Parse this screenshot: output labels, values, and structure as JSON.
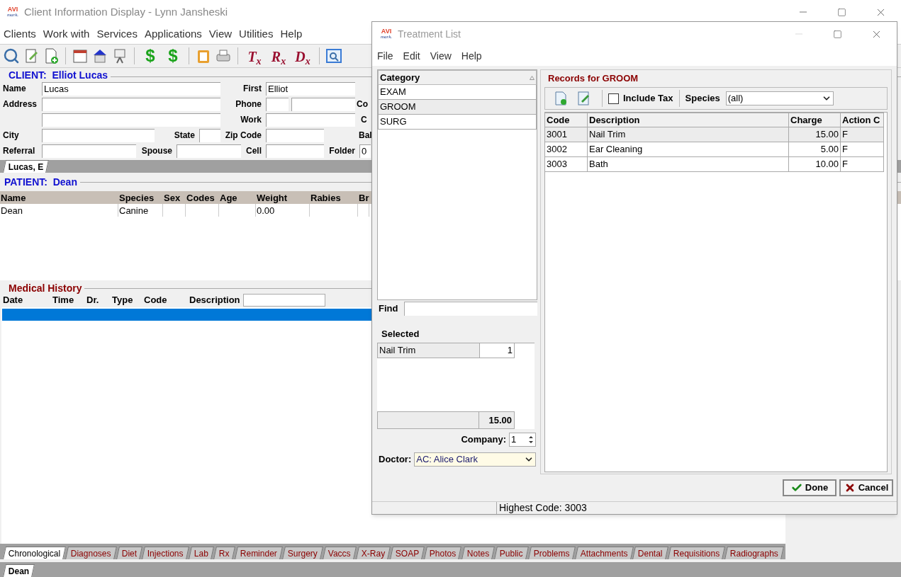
{
  "main_window": {
    "logo": {
      "top": "AVI",
      "bottom": "mark."
    },
    "title": "Client Information Display - Lynn Jansheski"
  },
  "menu": [
    "Clients",
    "Work with",
    "Services",
    "Applications",
    "View",
    "Utilities",
    "Help"
  ],
  "toolbar": {
    "symbols": [
      "$",
      "$",
      "T$_{x}$",
      "R$_{x}$",
      "D$_{x}$"
    ]
  },
  "client": {
    "heading": "CLIENT:  Elliot Lucas",
    "labels": {
      "name": "Name",
      "first": "First",
      "address": "Address",
      "phone": "Phone",
      "work": "Work",
      "city": "City",
      "state": "State",
      "zip": "Zip Code",
      "referral": "Referral",
      "spouse": "Spouse",
      "cell": "Cell",
      "folder": "Folder"
    },
    "cut_labels": [
      "Co",
      "C",
      "Bal"
    ],
    "values": {
      "name": "Lucas",
      "first": "Elliot",
      "folder": "0"
    }
  },
  "client_tabs": [
    {
      "label": "Lucas, E",
      "selected": true
    }
  ],
  "patient": {
    "heading": "PATIENT:  Dean",
    "columns": [
      "Name",
      "Species",
      "Sex",
      "Codes",
      "Age",
      "Weight",
      "Rabies",
      "Br"
    ],
    "rows": [
      [
        "Dean",
        "Canine",
        "",
        "",
        "",
        "0.00",
        "",
        ""
      ]
    ]
  },
  "medical_history": {
    "heading": "Medical History",
    "columns": [
      "Date",
      "Time",
      "Dr.",
      "Type",
      "Code",
      "Description"
    ]
  },
  "history_tabs": [
    {
      "label": "Chronological",
      "selected": true
    },
    {
      "label": "Diagnoses",
      "selected": false
    },
    {
      "label": "Diet",
      "selected": false
    },
    {
      "label": "Injections",
      "selected": false
    },
    {
      "label": "Lab",
      "selected": false
    },
    {
      "label": "Rx",
      "selected": false
    },
    {
      "label": "Reminder",
      "selected": false
    },
    {
      "label": "Surgery",
      "selected": false
    },
    {
      "label": "Vaccs",
      "selected": false
    },
    {
      "label": "X-Ray",
      "selected": false
    },
    {
      "label": "SOAP",
      "selected": false
    },
    {
      "label": "Photos",
      "selected": false
    },
    {
      "label": "Notes",
      "selected": false
    },
    {
      "label": "Public",
      "selected": false
    },
    {
      "label": "Problems",
      "selected": false
    },
    {
      "label": "Attachments",
      "selected": false
    },
    {
      "label": "Dental",
      "selected": false
    },
    {
      "label": "Requisitions",
      "selected": false
    },
    {
      "label": "Radiographs",
      "selected": false
    }
  ],
  "patient_tabs": [
    {
      "label": "Dean",
      "selected": true
    }
  ],
  "treatment_dialog": {
    "logo": {
      "top": "AVI",
      "bottom": "mark."
    },
    "title": "Treatment List",
    "menu": [
      "File",
      "Edit",
      "View",
      "Help"
    ],
    "category": {
      "heading": "Category",
      "items": [
        {
          "label": "EXAM",
          "selected": false
        },
        {
          "label": "GROOM",
          "selected": true
        },
        {
          "label": "SURG",
          "selected": false
        }
      ]
    },
    "find": {
      "label": "Find"
    },
    "selected": {
      "heading": "Selected",
      "rows": [
        {
          "description": "Nail Trim",
          "quantity": "1"
        }
      ],
      "total": "15.00"
    },
    "company": {
      "label": "Company:",
      "value": "1"
    },
    "doctor": {
      "label": "Doctor:",
      "value": "AC: Alice Clark"
    },
    "records": {
      "heading": "Records for GROOM",
      "include_tax": {
        "label": "Include Tax",
        "checked": false
      },
      "species": {
        "label": "Species",
        "value": "(all)"
      },
      "columns": [
        "Code",
        "Description",
        "Charge",
        "Action C"
      ],
      "rows": [
        {
          "cells": [
            "3001",
            "Nail Trim",
            "15.00",
            "F"
          ],
          "selected": true
        },
        {
          "cells": [
            "3002",
            "Ear Cleaning",
            "5.00",
            "F"
          ],
          "selected": false
        },
        {
          "cells": [
            "3003",
            "Bath",
            "10.00",
            "F"
          ],
          "selected": false
        }
      ]
    },
    "buttons": {
      "done": "Done",
      "cancel": "Cancel"
    },
    "status": "Highest Code: 3003"
  }
}
